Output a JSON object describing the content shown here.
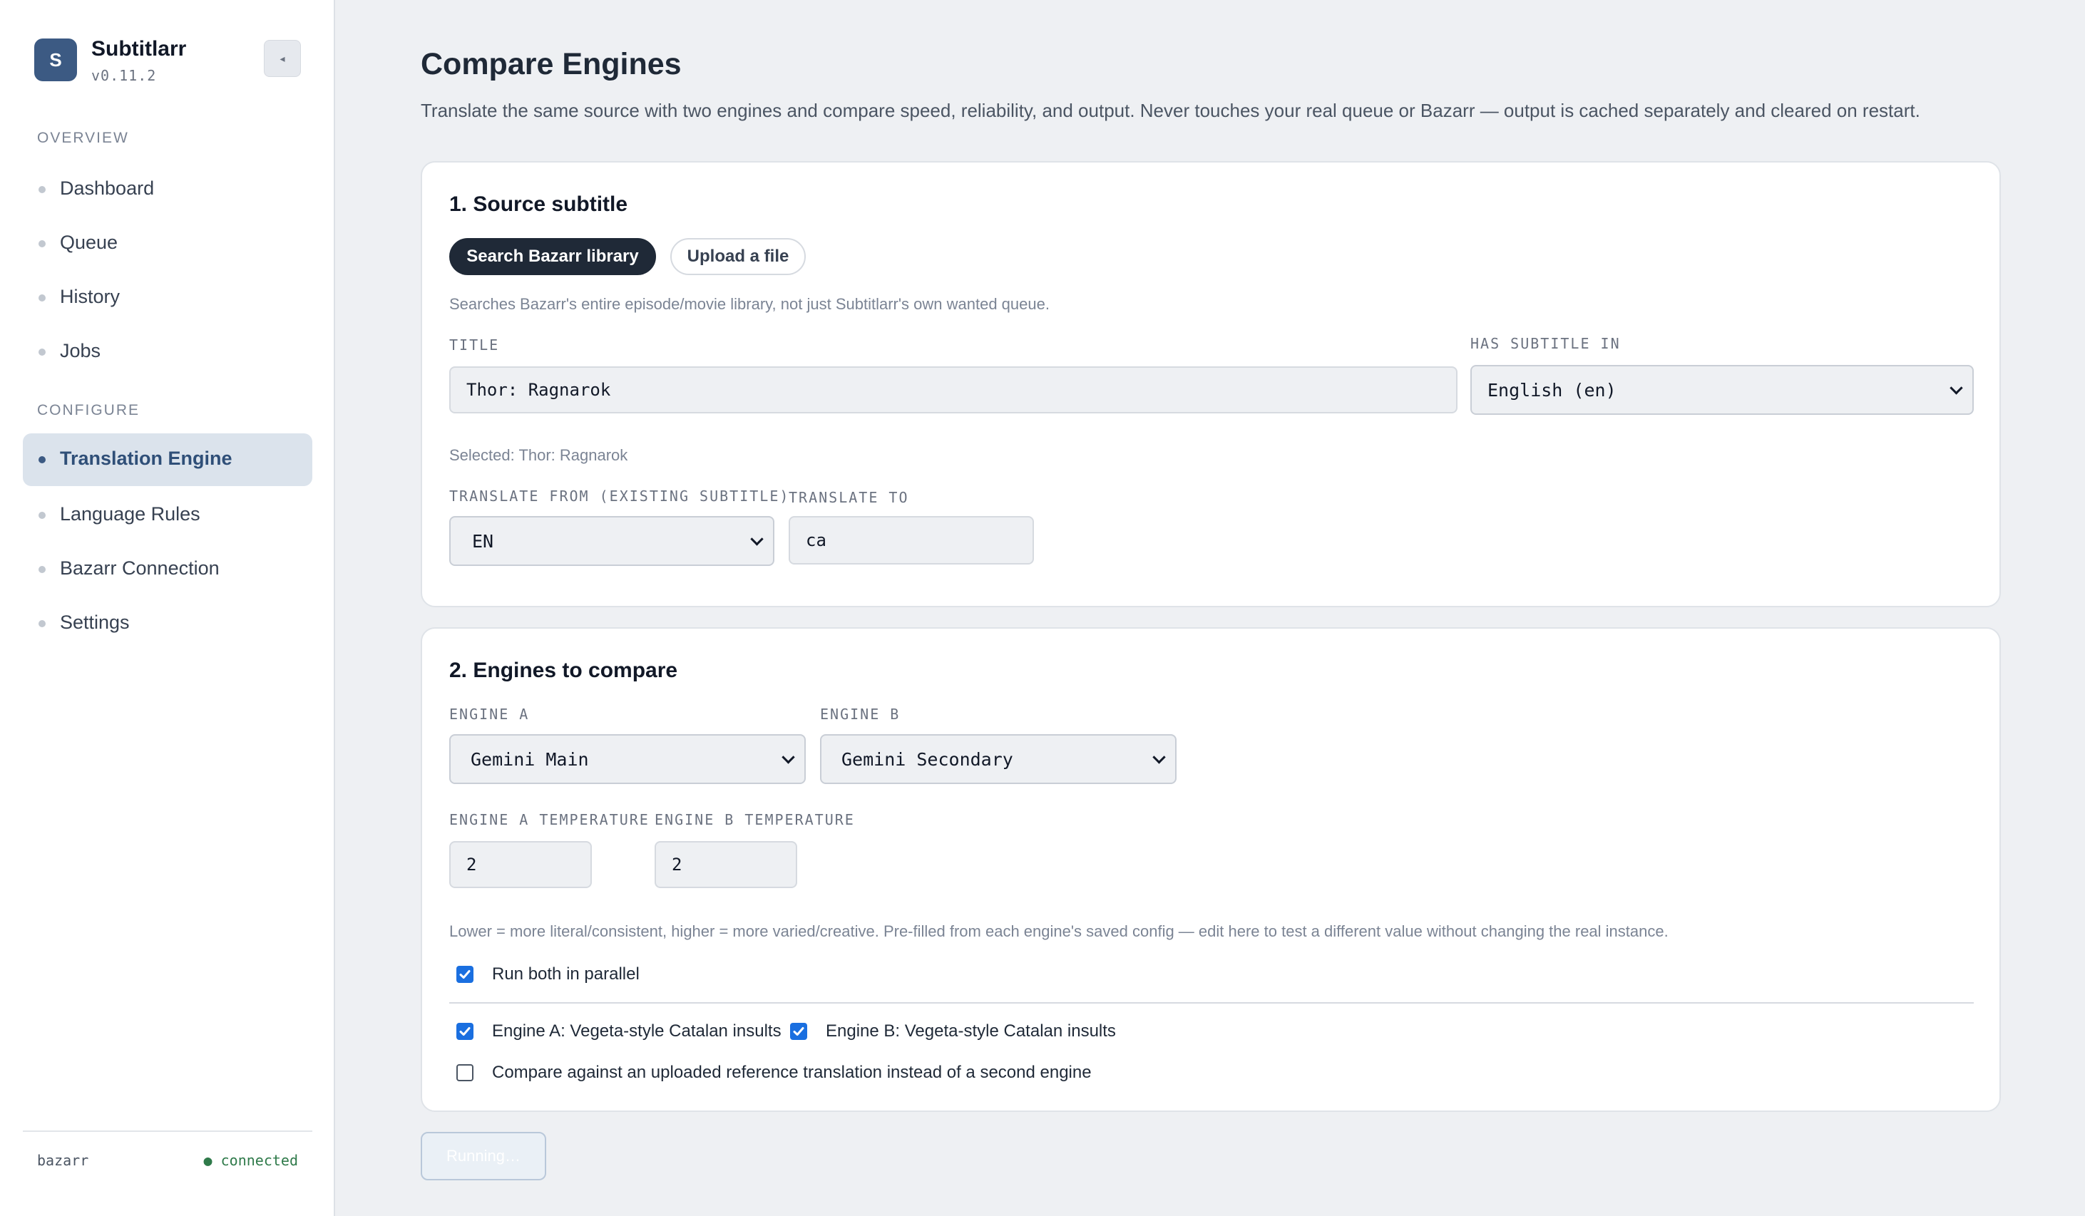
{
  "app": {
    "logo_letter": "S",
    "name": "Subtitlarr",
    "version": "v0.11.2",
    "collapse_glyph": "◂"
  },
  "sidebar": {
    "sections": [
      {
        "label": "OVERVIEW",
        "items": [
          {
            "label": "Dashboard",
            "active": false
          },
          {
            "label": "Queue",
            "active": false
          },
          {
            "label": "History",
            "active": false
          },
          {
            "label": "Jobs",
            "active": false
          }
        ]
      },
      {
        "label": "CONFIGURE",
        "items": [
          {
            "label": "Translation Engine",
            "active": true
          },
          {
            "label": "Language Rules",
            "active": false
          },
          {
            "label": "Bazarr Connection",
            "active": false
          },
          {
            "label": "Settings",
            "active": false
          }
        ]
      }
    ],
    "footer": {
      "service": "bazarr",
      "status": "● connected"
    }
  },
  "page": {
    "title": "Compare Engines",
    "description": "Translate the same source with two engines and compare speed, reliability, and output. Never touches your real queue or Bazarr — output is cached separately and cleared on restart."
  },
  "source_card": {
    "title": "1. Source subtitle",
    "tabs": {
      "search": "Search Bazarr library",
      "upload": "Upload a file"
    },
    "search_hint": "Searches Bazarr's entire episode/movie library, not just Subtitlarr's own wanted queue.",
    "title_label": "TITLE",
    "title_value": "Thor: Ragnarok",
    "has_subtitle_label": "HAS SUBTITLE IN",
    "has_subtitle_value": "English (en)",
    "selected_text": "Selected: Thor: Ragnarok",
    "translate_from_label": "TRANSLATE FROM (EXISTING SUBTITLE)",
    "translate_from_value": "EN",
    "translate_to_label": "TRANSLATE TO",
    "translate_to_value": "ca"
  },
  "engines_card": {
    "title": "2. Engines to compare",
    "engine_a_label": "ENGINE A",
    "engine_a_value": "Gemini Main",
    "engine_b_label": "ENGINE B",
    "engine_b_value": "Gemini Secondary",
    "temp_a_label": "ENGINE A TEMPERATURE",
    "temp_a_value": "2",
    "temp_b_label": "ENGINE B TEMPERATURE",
    "temp_b_value": "2",
    "temp_hint": "Lower = more literal/consistent, higher = more varied/creative. Pre-filled from each engine's saved config — edit here to test a different value without changing the real instance.",
    "parallel": {
      "label": "Run both in parallel",
      "checked": true
    },
    "prompt_a": {
      "label": "Engine A: Vegeta-style Catalan insults",
      "checked": true
    },
    "prompt_b": {
      "label": "Engine B: Vegeta-style Catalan insults",
      "checked": true
    },
    "reference": {
      "label": "Compare against an uploaded reference translation instead of a second engine",
      "checked": false
    }
  },
  "run_button": {
    "label": "Running…"
  },
  "colors": {
    "accent": "#3c5a83",
    "checkbox": "#1a6fe0",
    "connected": "#2f7a4a"
  }
}
